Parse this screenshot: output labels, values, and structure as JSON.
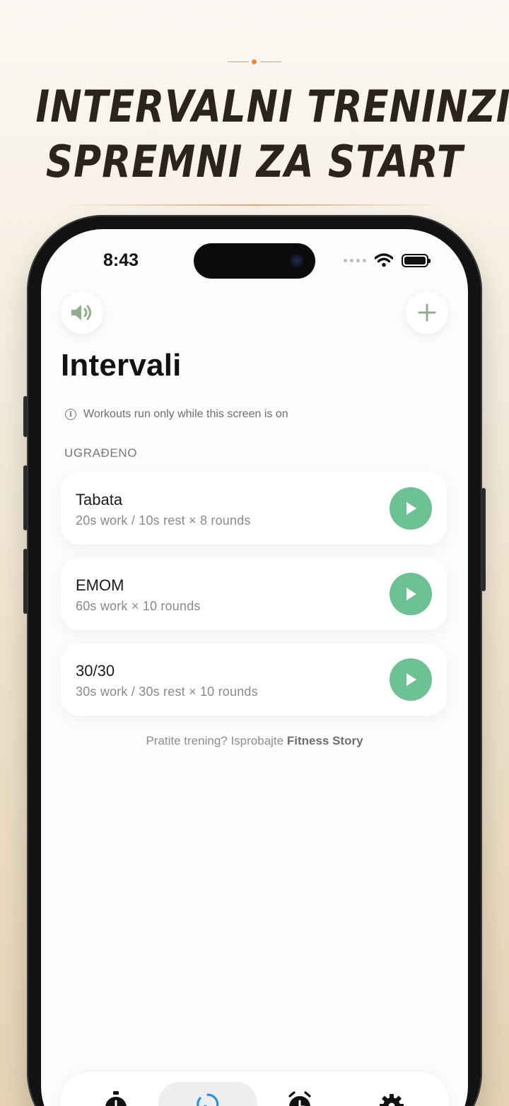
{
  "promo_header": {
    "headline_line1": "INTERVALNI TRENINZI",
    "headline_line2": "SPREMNI ZA START",
    "accent_color": "#e58a3a"
  },
  "status_bar": {
    "time": "8:43",
    "icons": [
      "signal-dots-icon",
      "wifi-icon",
      "battery-icon"
    ]
  },
  "toolbar": {
    "sound_icon": "speaker-icon",
    "add_icon": "plus-icon"
  },
  "page": {
    "title": "Intervali",
    "info_text": "Workouts run only while this screen is on",
    "section_label": "UGRAĐENO"
  },
  "workouts": [
    {
      "name": "Tabata",
      "description": "20s work / 10s rest × 8 rounds"
    },
    {
      "name": "EMOM",
      "description": "60s work × 10 rounds"
    },
    {
      "name": "30/30",
      "description": "30s work / 30s rest × 10 rounds"
    }
  ],
  "promo": {
    "text": "Pratite trening? Isprobajte",
    "link": "Fitness Story"
  },
  "tab_bar": {
    "tabs": [
      {
        "icon": "stopwatch-icon",
        "active": false
      },
      {
        "icon": "interval-timer-icon",
        "active": true
      },
      {
        "icon": "alarm-clock-icon",
        "active": false
      },
      {
        "icon": "gear-icon",
        "active": false
      }
    ]
  },
  "colors": {
    "play_button": "#6cc293",
    "active_tab_icon": "#2f8fe0",
    "icon_green": "#8fb08a"
  }
}
